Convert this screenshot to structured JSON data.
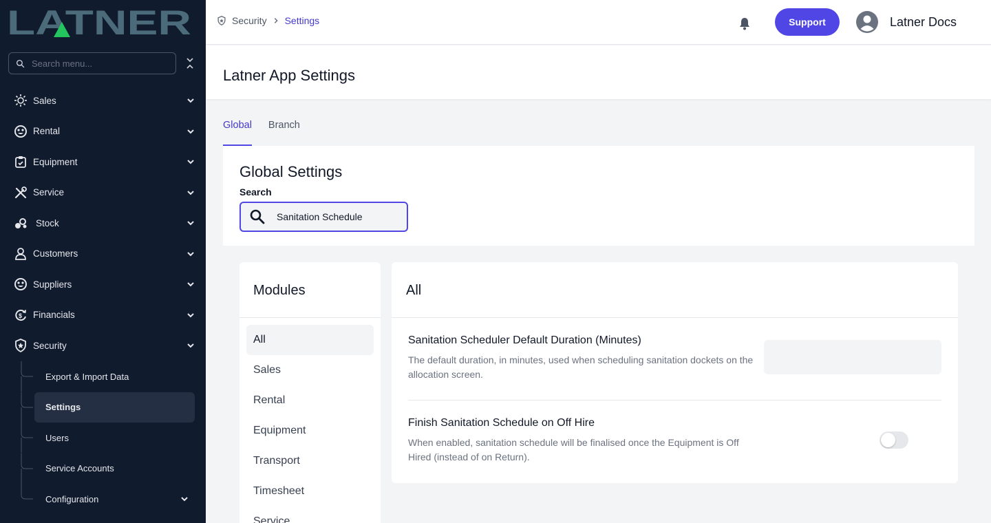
{
  "brand": {
    "logo_text": "LATNER",
    "logo_color": "#4b6b7a",
    "logo_accent": "#22c55e"
  },
  "sidebar": {
    "search_placeholder": "Search menu...",
    "items": [
      {
        "label": "Sales",
        "icon": "sales-icon"
      },
      {
        "label": "Rental",
        "icon": "rental-icon"
      },
      {
        "label": "Equipment",
        "icon": "equipment-icon"
      },
      {
        "label": "Service",
        "icon": "service-icon"
      },
      {
        "label": "Stock",
        "icon": "stock-icon"
      },
      {
        "label": "Customers",
        "icon": "customers-icon"
      },
      {
        "label": "Suppliers",
        "icon": "suppliers-icon"
      },
      {
        "label": "Financials",
        "icon": "financials-icon"
      },
      {
        "label": "Security",
        "icon": "security-icon"
      }
    ],
    "sub_items": [
      {
        "label": "Export & Import Data"
      },
      {
        "label": "Settings"
      },
      {
        "label": "Users"
      },
      {
        "label": "Service Accounts"
      },
      {
        "label": "Configuration"
      }
    ]
  },
  "topbar": {
    "breadcrumb": {
      "parent": "Security",
      "current": "Settings"
    },
    "support_label": "Support",
    "user_name": "Latner Docs"
  },
  "page": {
    "title": "Latner App Settings"
  },
  "tabs": [
    {
      "label": "Global"
    },
    {
      "label": "Branch"
    }
  ],
  "global_settings": {
    "title": "Global Settings",
    "search_label": "Search",
    "search_value": "Sanitation Schedule"
  },
  "modules": {
    "title": "Modules",
    "items": [
      "All",
      "Sales",
      "Rental",
      "Equipment",
      "Transport",
      "Timesheet",
      "Service"
    ]
  },
  "results": {
    "title": "All",
    "settings": [
      {
        "title": "Sanitation Scheduler Default Duration (Minutes)",
        "description": "The default duration, in minutes, used when scheduling sanitation dockets on the allocation screen.",
        "value": ""
      },
      {
        "title": "Finish Sanitation Schedule on Off Hire",
        "description": "When enabled, sanitation schedule will be finalised once the Equipment is Off Hired (instead of on Return).",
        "enabled": false
      }
    ]
  },
  "colors": {
    "accent": "#4f46e5",
    "sidebar_bg": "#111b2e"
  }
}
